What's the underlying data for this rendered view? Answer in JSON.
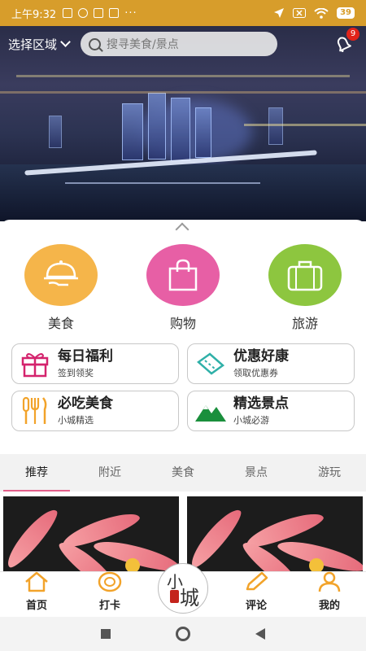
{
  "status_bar": {
    "time": "上午9:32",
    "dots": "···",
    "battery": "39"
  },
  "header": {
    "region_label": "选择区域",
    "search_placeholder": "搜寻美食/景点",
    "notification_count": "9"
  },
  "colors": {
    "status_bar": "#d79d2b",
    "food": "#f5b54a",
    "shopping": "#e75fa5",
    "travel": "#8dc63f",
    "tab_indicator": "#e35f8a"
  },
  "categories": [
    {
      "label": "美食",
      "icon": "food-cloche-icon"
    },
    {
      "label": "购物",
      "icon": "shopping-bag-icon"
    },
    {
      "label": "旅游",
      "icon": "suitcase-icon"
    }
  ],
  "features": [
    {
      "title": "每日福利",
      "subtitle": "签到领奖",
      "icon": "gift-icon"
    },
    {
      "title": "优惠好康",
      "subtitle": "领取优惠券",
      "icon": "ticket-icon"
    },
    {
      "title": "必吃美食",
      "subtitle": "小城精选",
      "icon": "utensils-icon"
    },
    {
      "title": "精选景点",
      "subtitle": "小城必游",
      "icon": "mountain-icon"
    }
  ],
  "tabs": [
    {
      "label": "推荐",
      "active": true
    },
    {
      "label": "附近",
      "active": false
    },
    {
      "label": "美食",
      "active": false
    },
    {
      "label": "景点",
      "active": false
    },
    {
      "label": "游玩",
      "active": false
    }
  ],
  "bottom_nav": {
    "items": [
      {
        "label": "首页",
        "icon": "home-icon"
      },
      {
        "label": "打卡",
        "icon": "checkin-icon"
      },
      {
        "label": "评论",
        "icon": "pencil-icon"
      },
      {
        "label": "我的",
        "icon": "user-icon"
      }
    ],
    "logo_text": "小城"
  }
}
